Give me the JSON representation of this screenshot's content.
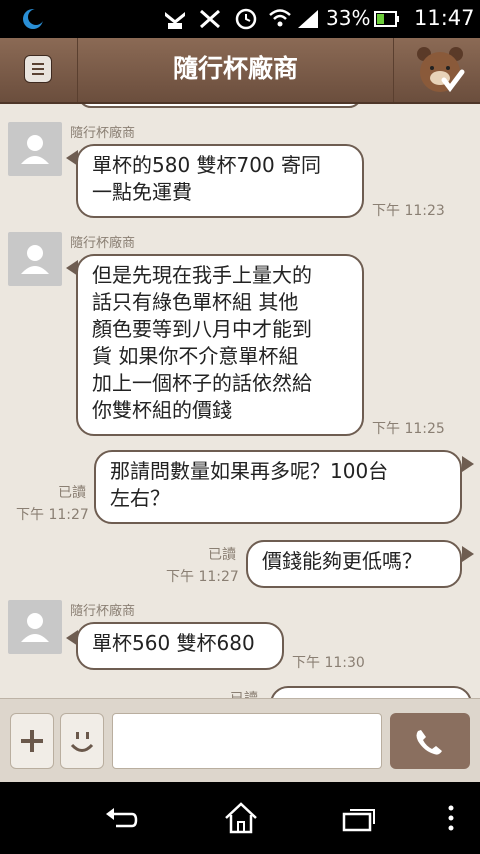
{
  "statusbar": {
    "battery": "33%",
    "time": "11:47"
  },
  "header": {
    "title": "隨行杯廠商"
  },
  "messages": [
    {
      "sender": "隨行杯廠商",
      "lines": [
        "單杯的580 雙杯700 寄同",
        "一點免運費"
      ],
      "time": "下午 11:23"
    },
    {
      "sender": "隨行杯廠商",
      "lines": [
        "但是先現在我手上量大的",
        "話只有綠色單杯組 其他",
        "顏色要等到八月中才能到",
        "貨 如果你不介意單杯組",
        "加上一個杯子的話依然給",
        "你雙杯組的價錢"
      ],
      "time": "下午 11:25"
    },
    {
      "read": "已讀",
      "lines": [
        "那請問數量如果再多呢？100台",
        "左右？"
      ],
      "time": "下午 11:27"
    },
    {
      "read": "已讀",
      "lines": [
        "價錢能夠更低嗎？"
      ],
      "time": "下午 11:27"
    },
    {
      "sender": "隨行杯廠商",
      "lines": [
        "單杯560 雙杯680"
      ],
      "time": "下午 11:30"
    }
  ],
  "partial": {
    "read": "已讀"
  },
  "input": {
    "placeholder": ""
  },
  "icons": {
    "menu": "menu-icon",
    "bear": "bear-sticker-icon",
    "plus": "plus-icon",
    "emoji": "emoji-icon",
    "call": "phone-icon",
    "back": "back-icon",
    "home": "home-icon",
    "recent": "recent-apps-icon",
    "more": "more-icon"
  },
  "colors": {
    "header": "#7a5b48",
    "chat_bg": "#ece7df",
    "bubble_border": "#6e5d51",
    "call": "#8a6f5f"
  }
}
